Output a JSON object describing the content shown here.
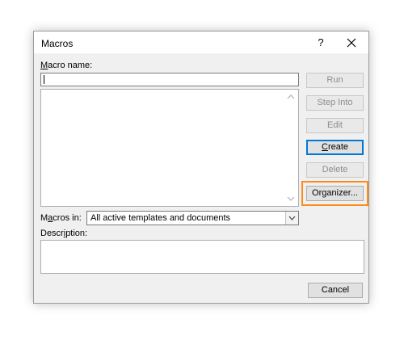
{
  "window": {
    "title": "Macros",
    "help_label": "?"
  },
  "macro_name": {
    "label_mnemonic": "M",
    "label_rest": "acro name:",
    "value": ""
  },
  "macro_list": [],
  "buttons": {
    "run": "Run",
    "step_into": "Step Into",
    "edit": "Edit",
    "create_mnemonic": "C",
    "create_rest": "reate",
    "delete": "Delete",
    "organizer_pre": "Or",
    "organizer_mnemonic": "g",
    "organizer_rest": "anizer...",
    "cancel": "Cancel"
  },
  "macros_in": {
    "label_pre": "M",
    "label_mnemonic": "a",
    "label_rest": "cros in:",
    "value": "All active templates and documents"
  },
  "description": {
    "label_pre": "Descr",
    "label_mnemonic": "i",
    "label_rest": "ption:",
    "value": ""
  },
  "colors": {
    "highlight": "#ff8c1a",
    "default_button_border": "#0078d7"
  }
}
